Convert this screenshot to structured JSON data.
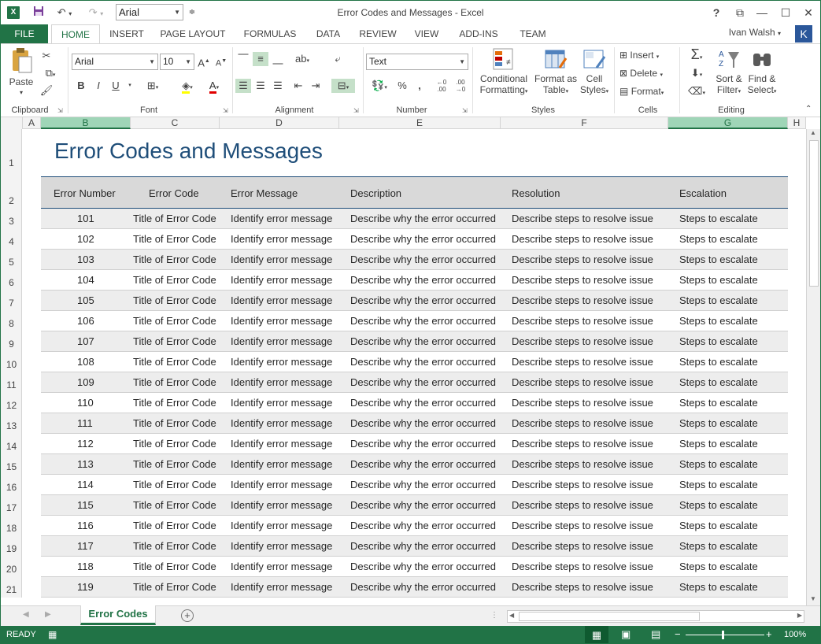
{
  "app": {
    "window_title": "Error Codes and Messages - Excel",
    "logo_letter": "X",
    "user_name": "Ivan Walsh",
    "user_initial": "K",
    "font_name": "Arial"
  },
  "qat": {
    "save_icon": "save-icon",
    "undo_icon": "undo-icon",
    "redo_icon": "redo-icon"
  },
  "window_controls": {
    "help": "?",
    "restore_ribbon": "⧉",
    "minimize": "—",
    "maximize": "☐",
    "close": "✕"
  },
  "tabs": {
    "file": "FILE",
    "items": [
      "HOME",
      "INSERT",
      "PAGE LAYOUT",
      "FORMULAS",
      "DATA",
      "REVIEW",
      "VIEW",
      "ADD-INS",
      "TEAM"
    ]
  },
  "ribbon": {
    "clipboard": {
      "label": "Clipboard",
      "paste": "Paste"
    },
    "font": {
      "label": "Font",
      "name": "Arial",
      "size": "10",
      "bold": "B",
      "italic": "I",
      "underline": "U"
    },
    "alignment": {
      "label": "Alignment"
    },
    "number": {
      "label": "Number",
      "format": "Text",
      "percent": "%",
      "comma": ","
    },
    "styles": {
      "label": "Styles",
      "conditional_1": "Conditional",
      "conditional_2": "Formatting",
      "format_table_1": "Format as",
      "format_table_2": "Table",
      "cell_styles_1": "Cell",
      "cell_styles_2": "Styles"
    },
    "cells": {
      "label": "Cells",
      "insert": "Insert",
      "delete": "Delete",
      "format": "Format"
    },
    "editing": {
      "label": "Editing",
      "sort_1": "Sort &",
      "sort_2": "Filter",
      "find_1": "Find &",
      "find_2": "Select"
    }
  },
  "columns": [
    "A",
    "B",
    "C",
    "D",
    "E",
    "F",
    "G",
    "H"
  ],
  "rows": [
    "1",
    "2",
    "3",
    "4",
    "5",
    "6",
    "7",
    "8",
    "9",
    "10",
    "11",
    "12",
    "13",
    "14",
    "15",
    "16",
    "17",
    "18",
    "19",
    "20",
    "21"
  ],
  "document": {
    "title": "Error Codes and Messages",
    "headers": [
      "Error Number",
      "Error Code",
      "Error Message",
      "Description",
      "Resolution",
      "Escalation"
    ],
    "code_title": "Title of Error Code",
    "message": "Identify error message",
    "description": "Describe why the error occurred",
    "resolution": "Describe steps to resolve issue",
    "escalation": "Steps to escalate",
    "numbers": [
      "101",
      "102",
      "103",
      "104",
      "105",
      "106",
      "107",
      "108",
      "109",
      "110",
      "111",
      "112",
      "113",
      "114",
      "115",
      "116",
      "117",
      "118",
      "119"
    ]
  },
  "sheet_tabs": {
    "active": "Error Codes",
    "add": "+"
  },
  "status": {
    "ready": "READY",
    "zoom": "100%"
  },
  "colors": {
    "excel_green": "#217346",
    "header_fill": "#d9d9d9",
    "title_blue": "#1f4e79"
  }
}
